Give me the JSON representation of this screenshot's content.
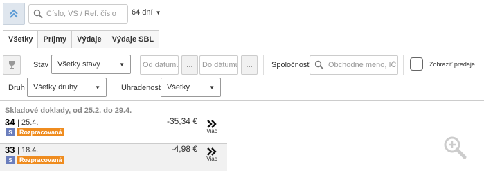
{
  "toolbar": {
    "collapse_icon": "chevrons-up-icon",
    "search": {
      "icon": "search-icon",
      "placeholder": "Číslo, VS / Ref. číslo"
    },
    "days": {
      "value": "64 dní"
    }
  },
  "tabs": [
    {
      "label": "Všetky",
      "active": true
    },
    {
      "label": "Príjmy",
      "active": false
    },
    {
      "label": "Výdaje",
      "active": false
    },
    {
      "label": "Výdaje SBL",
      "active": false
    }
  ],
  "filters": {
    "filter_icon": "trophy-filter-icon",
    "stav": {
      "label": "Stav",
      "value": "Všetky stavy"
    },
    "date_from": {
      "placeholder": "Od dátumu",
      "button": "..."
    },
    "date_to": {
      "placeholder": "Do dátumu",
      "button": "..."
    },
    "company": {
      "label": "Spoločnosť",
      "placeholder": "Obchodné meno, IČO"
    },
    "show_sales": {
      "label": "Zobraziť predaje",
      "checked": false
    },
    "druh": {
      "label": "Druh",
      "value": "Všetky druhy"
    },
    "uhradenost": {
      "label": "Uhradenosť",
      "value": "Všetky"
    }
  },
  "list": {
    "title": "Skladové doklady, od 25.2. do 29.4.",
    "rows": [
      {
        "number": "34",
        "separator": "|",
        "date": "25.4.",
        "type_badge": "S",
        "status": "Rozpracovaná",
        "amount": "-35,34 €",
        "more_label": "Viac"
      },
      {
        "number": "33",
        "separator": "|",
        "date": "18.4.",
        "type_badge": "S",
        "status": "Rozpracovaná",
        "amount": "-4,98 €",
        "more_label": "Viac"
      }
    ]
  },
  "colors": {
    "accent": "#5b9bd5",
    "status": "#ef8c1f",
    "badge": "#6b7ebd"
  },
  "zoom_icon": "zoom-in-icon"
}
